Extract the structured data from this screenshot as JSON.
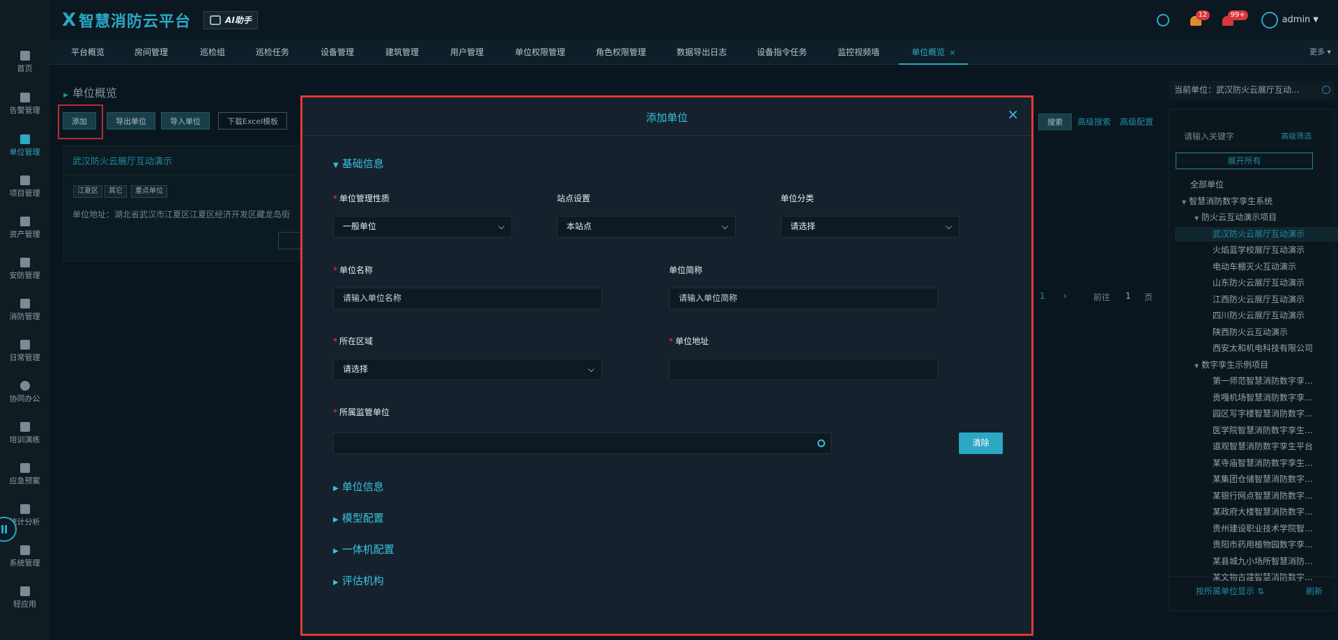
{
  "header": {
    "logo_mark": "X",
    "logo_text": "智慧消防云平台",
    "ai_label": "AI助手",
    "warning_count": "12",
    "alarm_count": "99+",
    "user": "admin"
  },
  "leftnav": [
    {
      "label": "首页"
    },
    {
      "label": "告警管理"
    },
    {
      "label": "单位管理",
      "active": true
    },
    {
      "label": "项目管理"
    },
    {
      "label": "资产管理"
    },
    {
      "label": "安防管理"
    },
    {
      "label": "消防管理"
    },
    {
      "label": "日常管理"
    },
    {
      "label": "协同办公"
    },
    {
      "label": "培训演练"
    },
    {
      "label": "应急预案"
    },
    {
      "label": "统计分析"
    },
    {
      "label": "系统管理"
    },
    {
      "label": "轻应用"
    }
  ],
  "tabs": [
    {
      "label": "平台概览"
    },
    {
      "label": "房间管理"
    },
    {
      "label": "巡检组"
    },
    {
      "label": "巡检任务"
    },
    {
      "label": "设备管理"
    },
    {
      "label": "建筑管理"
    },
    {
      "label": "用户管理"
    },
    {
      "label": "单位权限管理"
    },
    {
      "label": "角色权限管理"
    },
    {
      "label": "数据导出日志"
    },
    {
      "label": "设备指令任务"
    },
    {
      "label": "监控视频墙"
    },
    {
      "label": "单位概览",
      "active": true,
      "close": "×"
    }
  ],
  "more_label": "更多",
  "page": {
    "title": "单位概览",
    "toolbar": {
      "add": "添加",
      "export": "导出单位",
      "import": "导入单位",
      "download": "下载Excel模板"
    },
    "search": "搜索",
    "adv_search": "高级搜索",
    "adv_config": "高级配置",
    "card": {
      "title": "武汉防火云展厅互动演示",
      "tags": [
        "江夏区",
        "其它",
        "重点单位"
      ],
      "address": "单位地址：湖北省武汉市江夏区江夏区经济开发区藏龙岛街"
    },
    "pager": {
      "current": "1",
      "next": "›",
      "goto": "前往",
      "page_value": "1",
      "page_unit": "页"
    }
  },
  "right_panel": {
    "current_unit": "当前单位：武汉防火云展厅互动...",
    "search_placeholder": "请输入关键字",
    "adv_filter": "高级筛选",
    "expand_all": "展开所有",
    "tree": [
      {
        "label": "全部单位",
        "level": 0
      },
      {
        "label": "智慧消防数字孪生系统",
        "level": 1,
        "toggle": "▼"
      },
      {
        "label": "防火云互动演示项目",
        "level": 2,
        "toggle": "▼"
      },
      {
        "label": "武汉防火云展厅互动演示",
        "level": 3,
        "selected": true
      },
      {
        "label": "火焰蓝学校展厅互动演示",
        "level": 3
      },
      {
        "label": "电动车棚灭火互动演示",
        "level": 3
      },
      {
        "label": "山东防火云展厅互动演示",
        "level": 3
      },
      {
        "label": "江西防火云展厅互动演示",
        "level": 3
      },
      {
        "label": "四川防火云展厅互动演示",
        "level": 3
      },
      {
        "label": "陕西防火云互动演示",
        "level": 3
      },
      {
        "label": "西安太和机电科技有限公司",
        "level": 3
      },
      {
        "label": "数字孪生示例项目",
        "level": 2,
        "toggle": "▼"
      },
      {
        "label": "第一师范智慧消防数字孪...",
        "level": 3
      },
      {
        "label": "贡嘎机场智慧消防数字孪...",
        "level": 3
      },
      {
        "label": "园区写字楼智慧消防数字...",
        "level": 3
      },
      {
        "label": "医学院智慧消防数字孪生...",
        "level": 3
      },
      {
        "label": "道观智慧消防数字孪生平台",
        "level": 3
      },
      {
        "label": "某寺庙智慧消防数字孪生...",
        "level": 3
      },
      {
        "label": "某集团仓储智慧消防数字...",
        "level": 3
      },
      {
        "label": "某银行网点智慧消防数字...",
        "level": 3
      },
      {
        "label": "某政府大楼智慧消防数字...",
        "level": 3
      },
      {
        "label": "贵州建设职业技术学院智...",
        "level": 3
      },
      {
        "label": "贵阳市药用植物园数字孪...",
        "level": 3
      },
      {
        "label": "某县城九小场所智慧消防...",
        "level": 3
      },
      {
        "label": "某文物古建智慧消防数字...",
        "level": 3
      }
    ],
    "footer_left": "按所属单位显示 ⇅",
    "footer_right": "刷新"
  },
  "modal": {
    "title": "添加单位",
    "close": "×",
    "sections": {
      "basic": "基础信息",
      "unit_info": "单位信息",
      "model": "模型配置",
      "integrated": "一体机配置",
      "assessment": "评估机构"
    },
    "fields": {
      "mgmt_nature": {
        "label": "单位管理性质",
        "value": "一般单位"
      },
      "station": {
        "label": "站点设置",
        "value": "本站点"
      },
      "category": {
        "label": "单位分类",
        "value": "请选择"
      },
      "name": {
        "label": "单位名称",
        "placeholder": "请输入单位名称"
      },
      "short_name": {
        "label": "单位简称",
        "placeholder": "请输入单位简称"
      },
      "region": {
        "label": "所在区域",
        "value": "请选择"
      },
      "address": {
        "label": "单位地址",
        "value": ""
      },
      "supervisor": {
        "label": "所属监管单位",
        "value": ""
      }
    },
    "clear_btn": "清除"
  },
  "colors": {
    "accent": "#2aa9c6",
    "highlight_frame": "#e53935",
    "warning": "#e08a2e",
    "alarm": "#d9363e"
  }
}
